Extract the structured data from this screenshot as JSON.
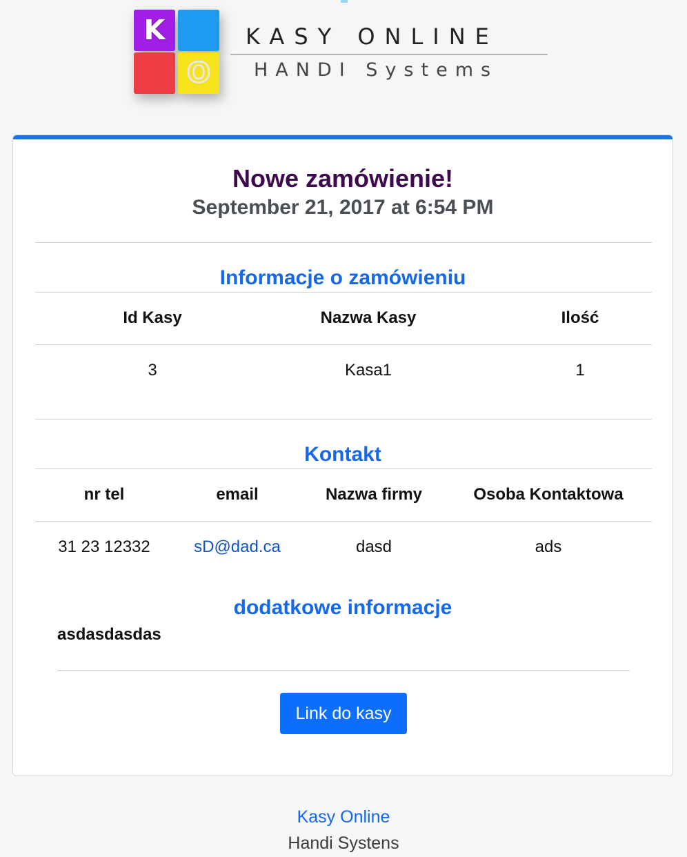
{
  "logo": {
    "tile_k": "K",
    "tile_o": "O",
    "title": "KASY ONLINE",
    "subtitle": "HANDI Systems",
    "colors": {
      "purple": "#a21ee6",
      "blue": "#1d9bf0",
      "red": "#ef3d45",
      "yellow": "#f6e31c"
    }
  },
  "order": {
    "title": "Nowe zamówienie!",
    "date": "September 21, 2017 at 6:54 PM"
  },
  "order_info": {
    "heading": "Informacje o zamówieniu",
    "headers": [
      "Id Kasy",
      "Nazwa Kasy",
      "Ilość"
    ],
    "rows": [
      [
        "3",
        "Kasa1",
        "1"
      ]
    ]
  },
  "contact": {
    "heading": "Kontakt",
    "headers": [
      "nr tel",
      "email",
      "Nazwa firmy",
      "Osoba Kontaktowa"
    ],
    "rows": [
      [
        "31 23 12332",
        "sD@dad.ca",
        "dasd",
        "ads"
      ]
    ]
  },
  "extra": {
    "heading": "dodatkowe informacje",
    "text": "asdasdasdas"
  },
  "button": {
    "label": "Link do kasy"
  },
  "footer": {
    "link": "Kasy Online",
    "text": "Handi Systens"
  },
  "colors": {
    "accent": "#1a73e8",
    "heading_blue": "#1568e8",
    "title_purple": "#3d0a4e",
    "button": "#0d6efd"
  }
}
